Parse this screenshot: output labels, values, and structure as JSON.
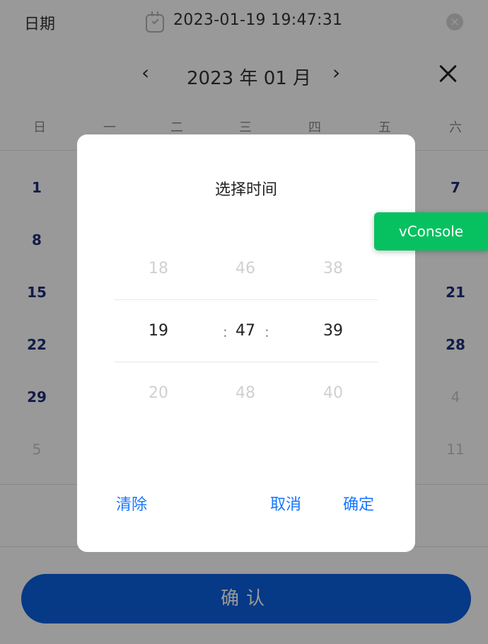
{
  "field": {
    "label": "日期",
    "value": "2023-01-19 19:47:31",
    "icon": "calendar-check-icon",
    "clear_icon": "clear-circle-icon"
  },
  "calendar": {
    "title": "2023 年 01 月",
    "prev": "‹",
    "next": "›",
    "close": "×",
    "weekdays": [
      "日",
      "一",
      "二",
      "三",
      "四",
      "五",
      "六"
    ],
    "visible_days": {
      "col_sun": [
        "1",
        "8",
        "15",
        "22",
        "29",
        "5"
      ],
      "col_sat": [
        "7",
        "",
        "21",
        "28",
        "4",
        "11"
      ]
    }
  },
  "dialog": {
    "title": "选择时间",
    "hours": [
      "18",
      "19",
      "20"
    ],
    "minutes": [
      "46",
      "47",
      "48"
    ],
    "seconds": [
      "38",
      "39",
      "40"
    ],
    "separator": ":",
    "clear": "清除",
    "cancel": "取消",
    "ok": "确定"
  },
  "confirm_label": "确认",
  "vconsole_label": "vConsole",
  "colors": {
    "accent": "#1677ff",
    "primary_button": "#0a5fe0",
    "day_text": "#1f2f7a",
    "vconsole": "#07c160"
  }
}
